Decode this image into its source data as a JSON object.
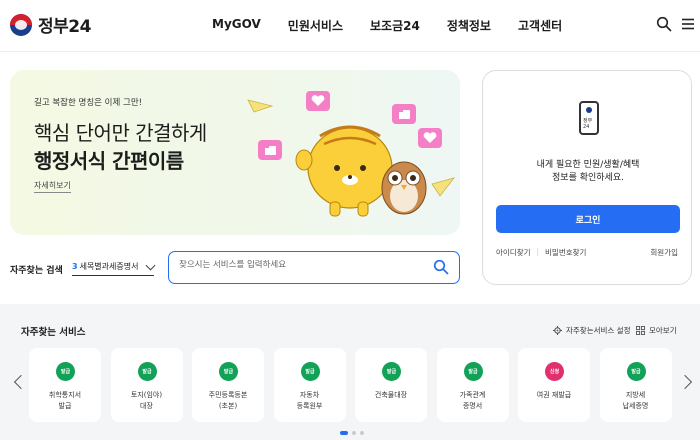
{
  "header": {
    "logo_text": "정부24",
    "nav": [
      "MyGOV",
      "민원서비스",
      "보조금24",
      "정책정보",
      "고객센터"
    ],
    "icons": [
      "search-icon",
      "menu-icon"
    ]
  },
  "hero": {
    "subtitle": "길고 복잡한 명칭은 이제 그만!",
    "line1": "핵심 단어만 간결하게",
    "line2": "행정서식 간편이름",
    "more_link": "자세히보기"
  },
  "login": {
    "phone_label": "정부24",
    "desc_line1": "내게 필요한 민원/생활/혜택",
    "desc_line2": "정보를 확인하세요.",
    "button": "로그인",
    "find_id": "아이디찾기",
    "find_pw": "비밀번호찾기",
    "signup": "회원가입"
  },
  "search": {
    "label": "자주찾는 검색",
    "select_num": "3",
    "select_value": "세목별과세증명서",
    "placeholder": "찾으시는 서비스를 입력하세요"
  },
  "services": {
    "title": "자주찾는 서비스",
    "setting_label": "자주찾는서비스 설정",
    "view_all_label": "모아보기",
    "items": [
      {
        "badge": "발급",
        "label": "취학통지서\n발급",
        "color": "#12a257"
      },
      {
        "badge": "발급",
        "label": "토지(임야)\n대장",
        "color": "#12a257"
      },
      {
        "badge": "발급",
        "label": "주민등록등본\n(초본)",
        "color": "#12a257"
      },
      {
        "badge": "발급",
        "label": "자동차\n등록원부",
        "color": "#12a257"
      },
      {
        "badge": "발급",
        "label": "건축물대장",
        "color": "#12a257"
      },
      {
        "badge": "발급",
        "label": "가족관계\n증명서",
        "color": "#12a257"
      },
      {
        "badge": "신청",
        "label": "여권 재발급",
        "color": "#e0306f"
      },
      {
        "badge": "발급",
        "label": "지방세\n납세증명",
        "color": "#12a257"
      }
    ]
  },
  "colors": {
    "accent": "#256ef4",
    "issue_badge": "#12a257",
    "apply_badge": "#e0306f"
  }
}
